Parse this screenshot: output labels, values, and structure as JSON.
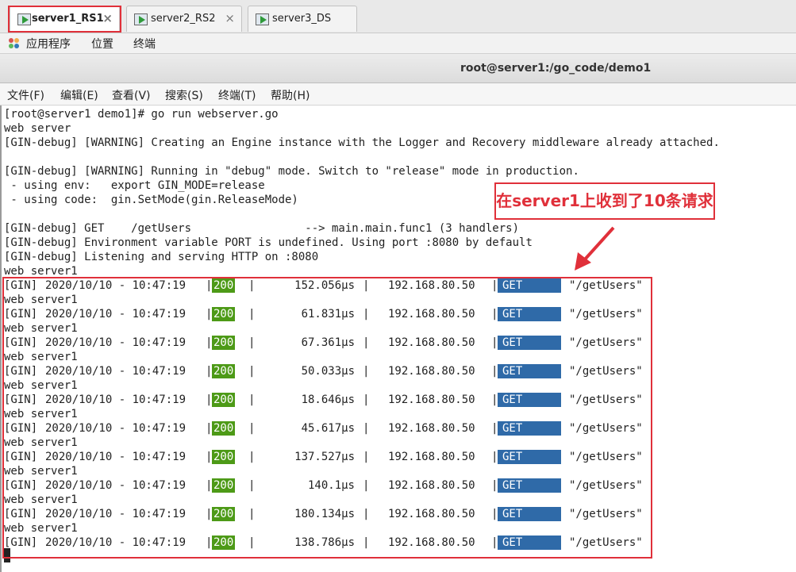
{
  "tabs": [
    {
      "label": "server1_RS1",
      "close": "×",
      "active": true
    },
    {
      "label": "server2_RS2",
      "close": "×",
      "active": false
    },
    {
      "label": "server3_DS",
      "close": "",
      "active": false
    }
  ],
  "app_menu": [
    "应用程序",
    "位置",
    "终端"
  ],
  "window_title": "root@server1:/go_code/demo1",
  "terminal_menu": [
    "文件(F)",
    "编辑(E)",
    "查看(V)",
    "搜索(S)",
    "终端(T)",
    "帮助(H)"
  ],
  "terminal_lines": [
    "[root@server1 demo1]# go run webserver.go",
    "web server",
    "[GIN-debug] [WARNING] Creating an Engine instance with the Logger and Recovery middleware already attached.",
    "",
    "[GIN-debug] [WARNING] Running in \"debug\" mode. Switch to \"release\" mode in production.",
    " - using env:   export GIN_MODE=release",
    " - using code:  gin.SetMode(gin.ReleaseMode)",
    "",
    "[GIN-debug] GET    /getUsers                 --> main.main.func1 (3 handlers)",
    "[GIN-debug] Environment variable PORT is undefined. Using port :8080 by default",
    "[GIN-debug] Listening and serving HTTP on :8080",
    "web server1"
  ],
  "log_entries": [
    {
      "prefix": "[GIN]",
      "time": "2020/10/10 - 10:47:19",
      "status": "200",
      "latency": "152.056µs",
      "ip": "192.168.80.50",
      "method": "GET",
      "path": "\"/getUsers\"",
      "after": "web server1"
    },
    {
      "prefix": "[GIN]",
      "time": "2020/10/10 - 10:47:19",
      "status": "200",
      "latency": "61.831µs",
      "ip": "192.168.80.50",
      "method": "GET",
      "path": "\"/getUsers\"",
      "after": "web server1"
    },
    {
      "prefix": "[GIN]",
      "time": "2020/10/10 - 10:47:19",
      "status": "200",
      "latency": "67.361µs",
      "ip": "192.168.80.50",
      "method": "GET",
      "path": "\"/getUsers\"",
      "after": "web server1"
    },
    {
      "prefix": "[GIN]",
      "time": "2020/10/10 - 10:47:19",
      "status": "200",
      "latency": "50.033µs",
      "ip": "192.168.80.50",
      "method": "GET",
      "path": "\"/getUsers\"",
      "after": "web server1"
    },
    {
      "prefix": "[GIN]",
      "time": "2020/10/10 - 10:47:19",
      "status": "200",
      "latency": "18.646µs",
      "ip": "192.168.80.50",
      "method": "GET",
      "path": "\"/getUsers\"",
      "after": "web server1"
    },
    {
      "prefix": "[GIN]",
      "time": "2020/10/10 - 10:47:19",
      "status": "200",
      "latency": "45.617µs",
      "ip": "192.168.80.50",
      "method": "GET",
      "path": "\"/getUsers\"",
      "after": "web server1"
    },
    {
      "prefix": "[GIN]",
      "time": "2020/10/10 - 10:47:19",
      "status": "200",
      "latency": "137.527µs",
      "ip": "192.168.80.50",
      "method": "GET",
      "path": "\"/getUsers\"",
      "after": "web server1"
    },
    {
      "prefix": "[GIN]",
      "time": "2020/10/10 - 10:47:19",
      "status": "200",
      "latency": "140.1µs",
      "ip": "192.168.80.50",
      "method": "GET",
      "path": "\"/getUsers\"",
      "after": "web server1"
    },
    {
      "prefix": "[GIN]",
      "time": "2020/10/10 - 10:47:19",
      "status": "200",
      "latency": "180.134µs",
      "ip": "192.168.80.50",
      "method": "GET",
      "path": "\"/getUsers\"",
      "after": "web server1"
    },
    {
      "prefix": "[GIN]",
      "time": "2020/10/10 - 10:47:19",
      "status": "200",
      "latency": "138.786µs",
      "ip": "192.168.80.50",
      "method": "GET",
      "path": "\"/getUsers\"",
      "after": ""
    }
  ],
  "pipe": "|",
  "annotation": "在server1上收到了10条请求",
  "colors": {
    "status_ok": "#4d9a17",
    "method_get": "#2f6aa8",
    "highlight": "#e0303a"
  }
}
